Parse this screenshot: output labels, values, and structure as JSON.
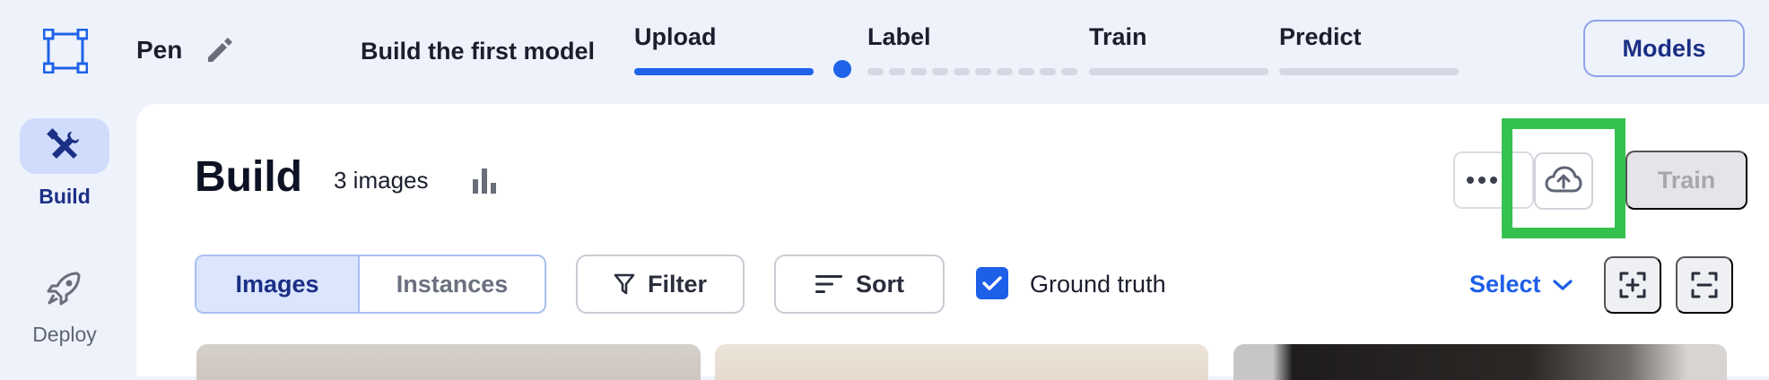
{
  "header": {
    "project_name": "Pen",
    "build_first_model": "Build the first model",
    "steps": [
      {
        "label": "Upload",
        "status": "complete"
      },
      {
        "label": "Label",
        "status": "in-progress"
      },
      {
        "label": "Train",
        "status": "pending"
      },
      {
        "label": "Predict",
        "status": "pending"
      }
    ],
    "models_button": "Models"
  },
  "sidebar": {
    "items": [
      {
        "label": "Build",
        "icon": "tools-icon",
        "active": true
      },
      {
        "label": "Deploy",
        "icon": "rocket-icon",
        "active": false
      }
    ]
  },
  "main": {
    "title": "Build",
    "image_count": "3 images",
    "train_button": "Train",
    "view_tabs": [
      {
        "label": "Images",
        "active": true
      },
      {
        "label": "Instances",
        "active": false
      }
    ],
    "filter_label": "Filter",
    "sort_label": "Sort",
    "ground_truth": {
      "label": "Ground truth",
      "checked": true
    },
    "select_label": "Select"
  },
  "colors": {
    "accent": "#1e63e9",
    "highlight": "#35c14f",
    "background": "#eef2fb"
  }
}
